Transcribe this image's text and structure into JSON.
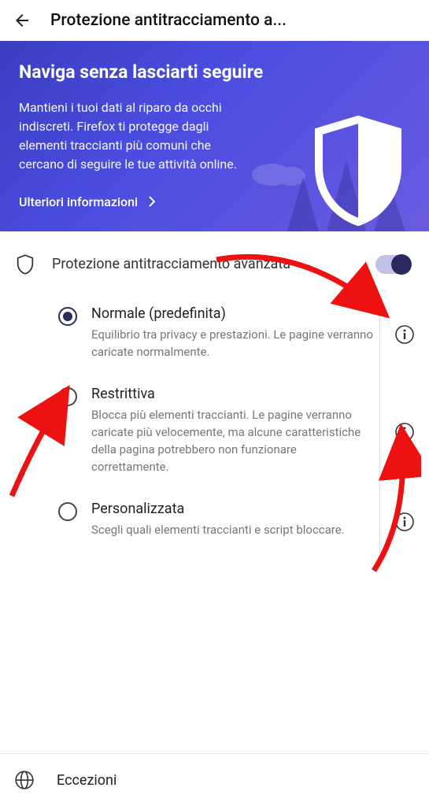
{
  "header": {
    "title": "Protezione antitracciamento a..."
  },
  "hero": {
    "title": "Naviga senza lasciarti seguire",
    "description": "Mantieni i tuoi dati al riparo da occhi indiscreti. Firefox ti protegge dagli elementi traccianti più comuni che cercano di seguire le tue attività online.",
    "link": "Ulteriori informazioni"
  },
  "toggle": {
    "label": "Protezione antitracciamento avanzata",
    "enabled": true
  },
  "options": [
    {
      "title": "Normale (predefinita)",
      "description": "Equilibrio tra privacy e prestazioni. Le pagine verranno caricate normalmente.",
      "selected": true
    },
    {
      "title": "Restrittiva",
      "description": "Blocca più elementi traccianti. Le pagine verranno caricate più velocemente, ma alcune caratteristiche della pagina potrebbero non funzionare correttamente.",
      "selected": false
    },
    {
      "title": "Personalizzata",
      "description": "Scegli quali elementi traccianti e script bloccare.",
      "selected": false
    }
  ],
  "exceptions": {
    "label": "Eccezioni"
  },
  "colors": {
    "accent": "#2a2a5e",
    "arrow": "#e11"
  }
}
